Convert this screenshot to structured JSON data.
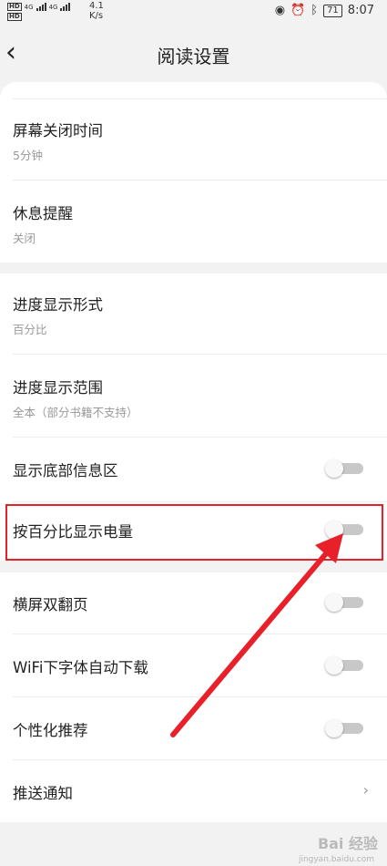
{
  "status_bar": {
    "net_label_1": "HD",
    "net_label_2": "HD",
    "signal_type_1": "4G",
    "signal_type_2": "4G",
    "speed_value": "4.1",
    "speed_unit": "K/s",
    "battery": "71",
    "time": "8:07"
  },
  "header": {
    "title": "阅读设置"
  },
  "settings": {
    "screen_off": {
      "title": "屏幕关闭时间",
      "value": "5分钟"
    },
    "rest_reminder": {
      "title": "休息提醒",
      "value": "关闭"
    },
    "progress_style": {
      "title": "进度显示形式",
      "value": "百分比"
    },
    "progress_range": {
      "title": "进度显示范围",
      "value": "全本（部分书籍不支持）"
    },
    "bottom_info": {
      "title": "显示底部信息区",
      "enabled": false
    },
    "battery_percent": {
      "title": "按百分比显示电量",
      "enabled": false
    },
    "landscape_double": {
      "title": "横屏双翻页",
      "enabled": false
    },
    "wifi_font_download": {
      "title": "WiFi下字体自动下载",
      "enabled": false
    },
    "personalized": {
      "title": "个性化推荐",
      "enabled": false
    },
    "push": {
      "title": "推送通知",
      "chevron": "›"
    }
  },
  "watermark": {
    "brand": "Bai 经验",
    "url": "jingyan.baidu.com"
  },
  "colors": {
    "highlight": "#e8202a",
    "toggle_off_track": "#c8c8c8"
  }
}
